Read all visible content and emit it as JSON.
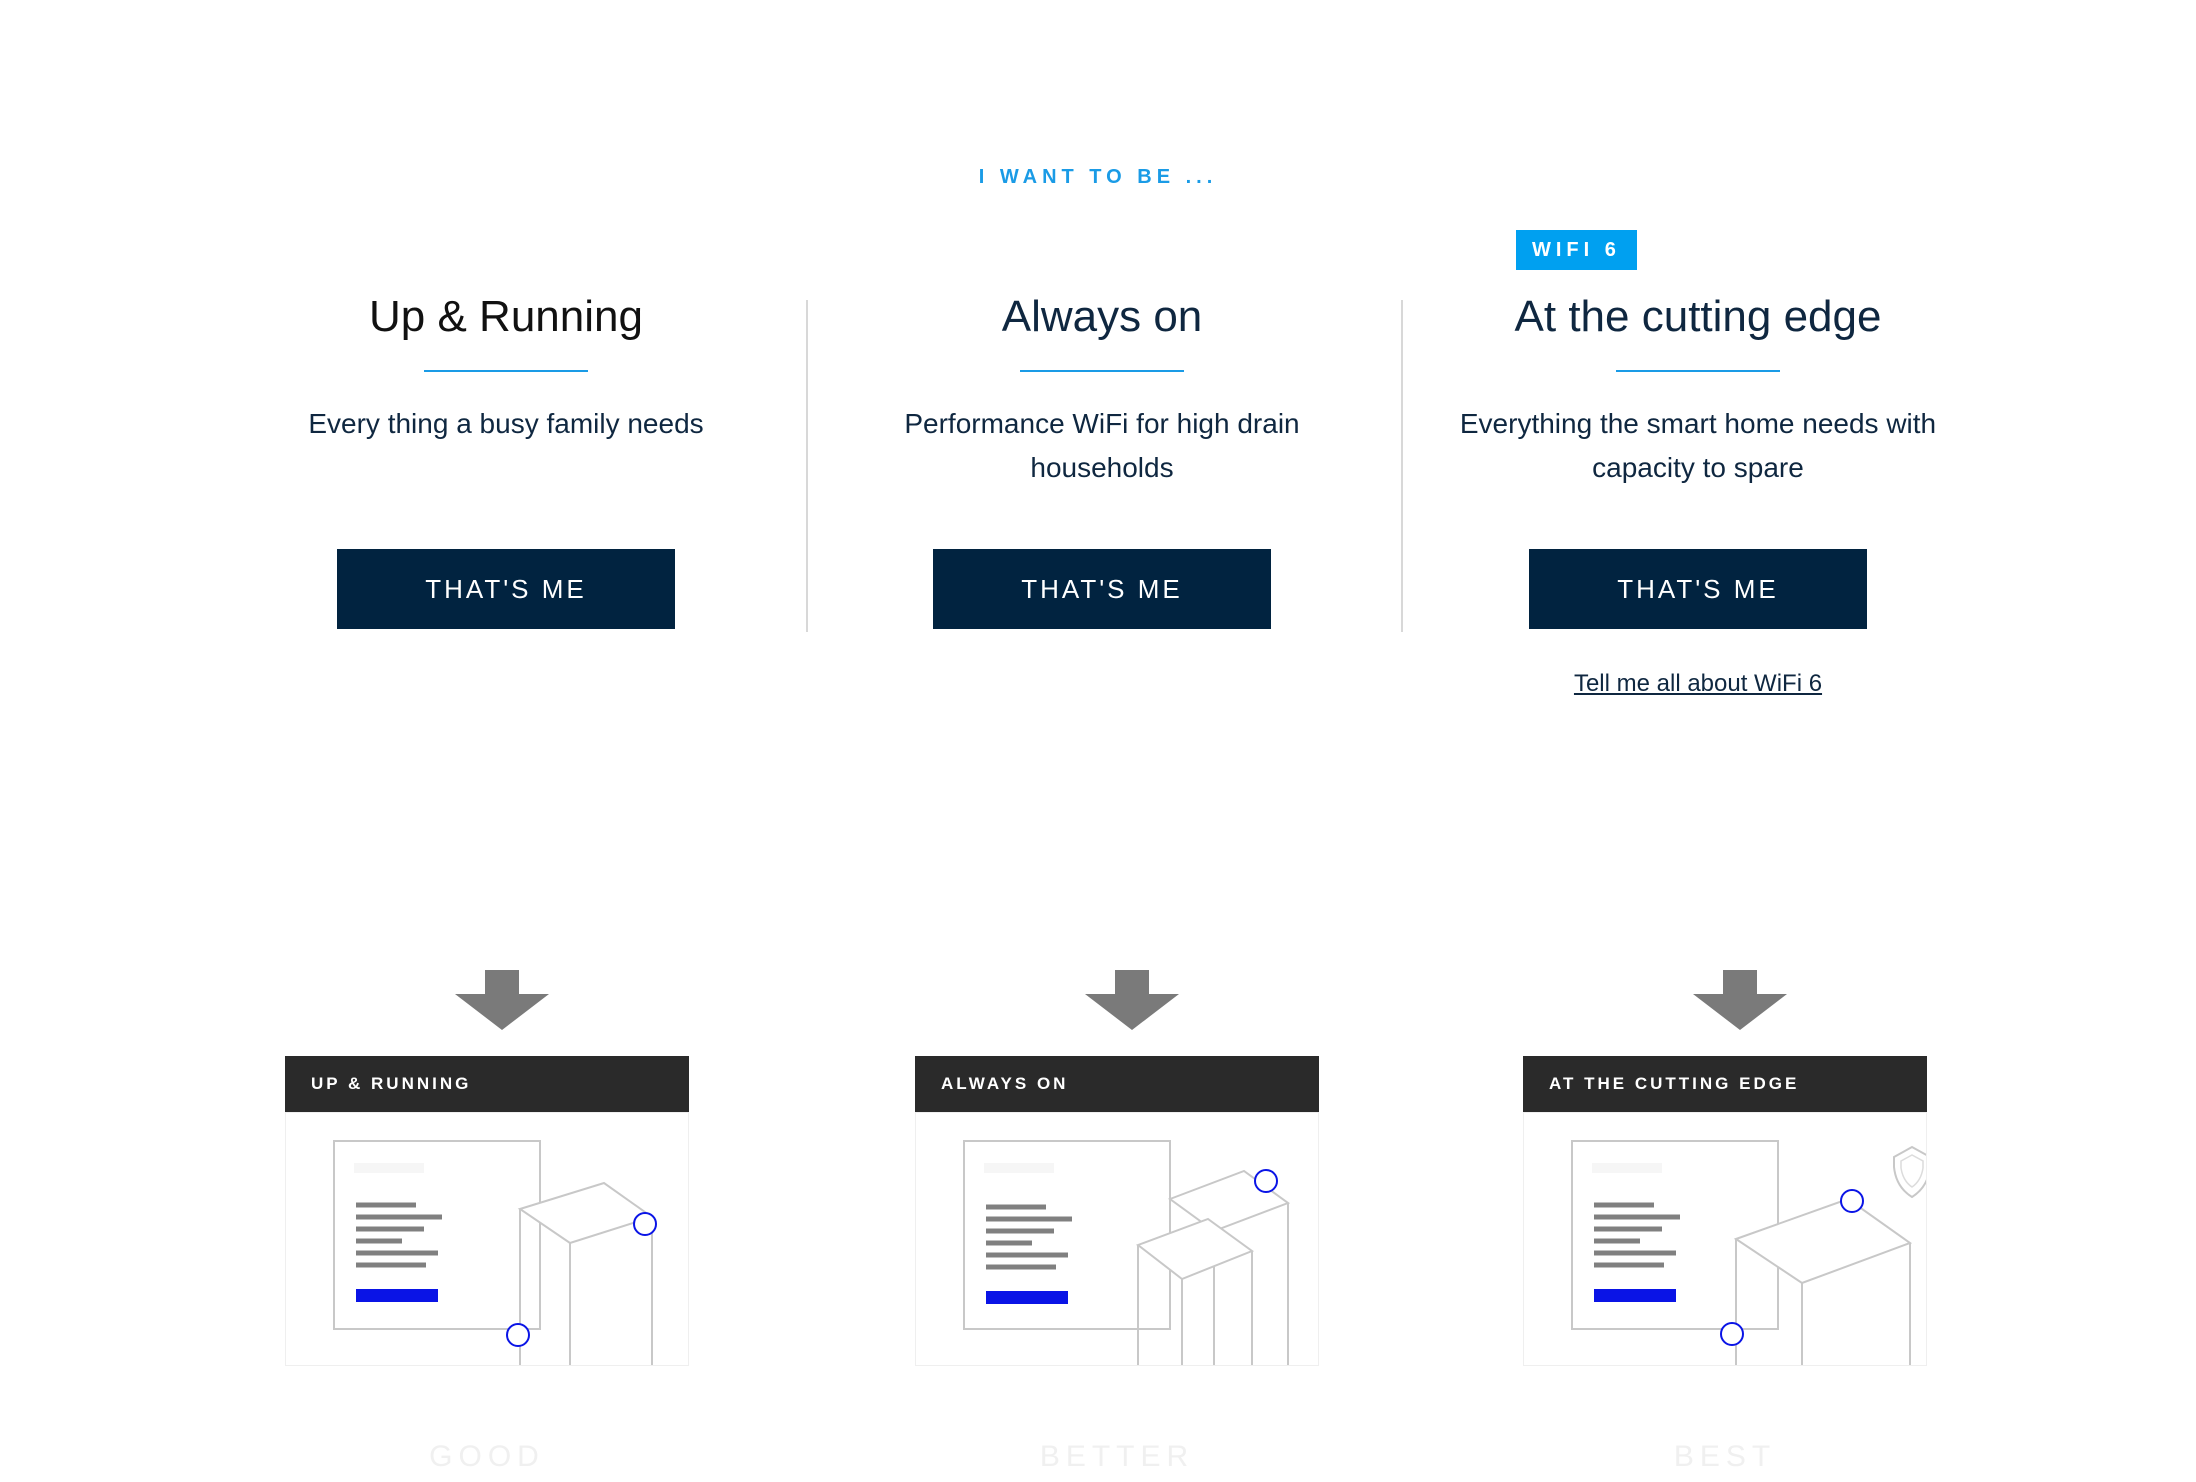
{
  "header": {
    "eyebrow": "I WANT TO BE ..."
  },
  "options": [
    {
      "title": "Up & Running",
      "description": "Every thing a busy family needs",
      "cta": "THAT'S ME"
    },
    {
      "title": "Always on",
      "description": "Performance WiFi for high drain households",
      "cta": "THAT'S ME"
    },
    {
      "badge": "WIFI 6",
      "title": "At the cutting edge",
      "description": "Everything the smart home needs with capacity to spare",
      "cta": "THAT'S ME",
      "link": "Tell me all about WiFi 6"
    }
  ],
  "cards": [
    {
      "header": "UP & RUNNING",
      "footer": "GOOD"
    },
    {
      "header": "ALWAYS ON",
      "footer": "BETTER"
    },
    {
      "header": "AT THE CUTTING EDGE",
      "footer": "BEST"
    }
  ],
  "colors": {
    "accent": "#1a9be6",
    "badge": "#00a0f0",
    "button": "#012340",
    "card_header": "#2a2a2a",
    "illustration_accent": "#0a14e6"
  },
  "icons": [
    "down-arrow-icon",
    "shield-icon"
  ]
}
